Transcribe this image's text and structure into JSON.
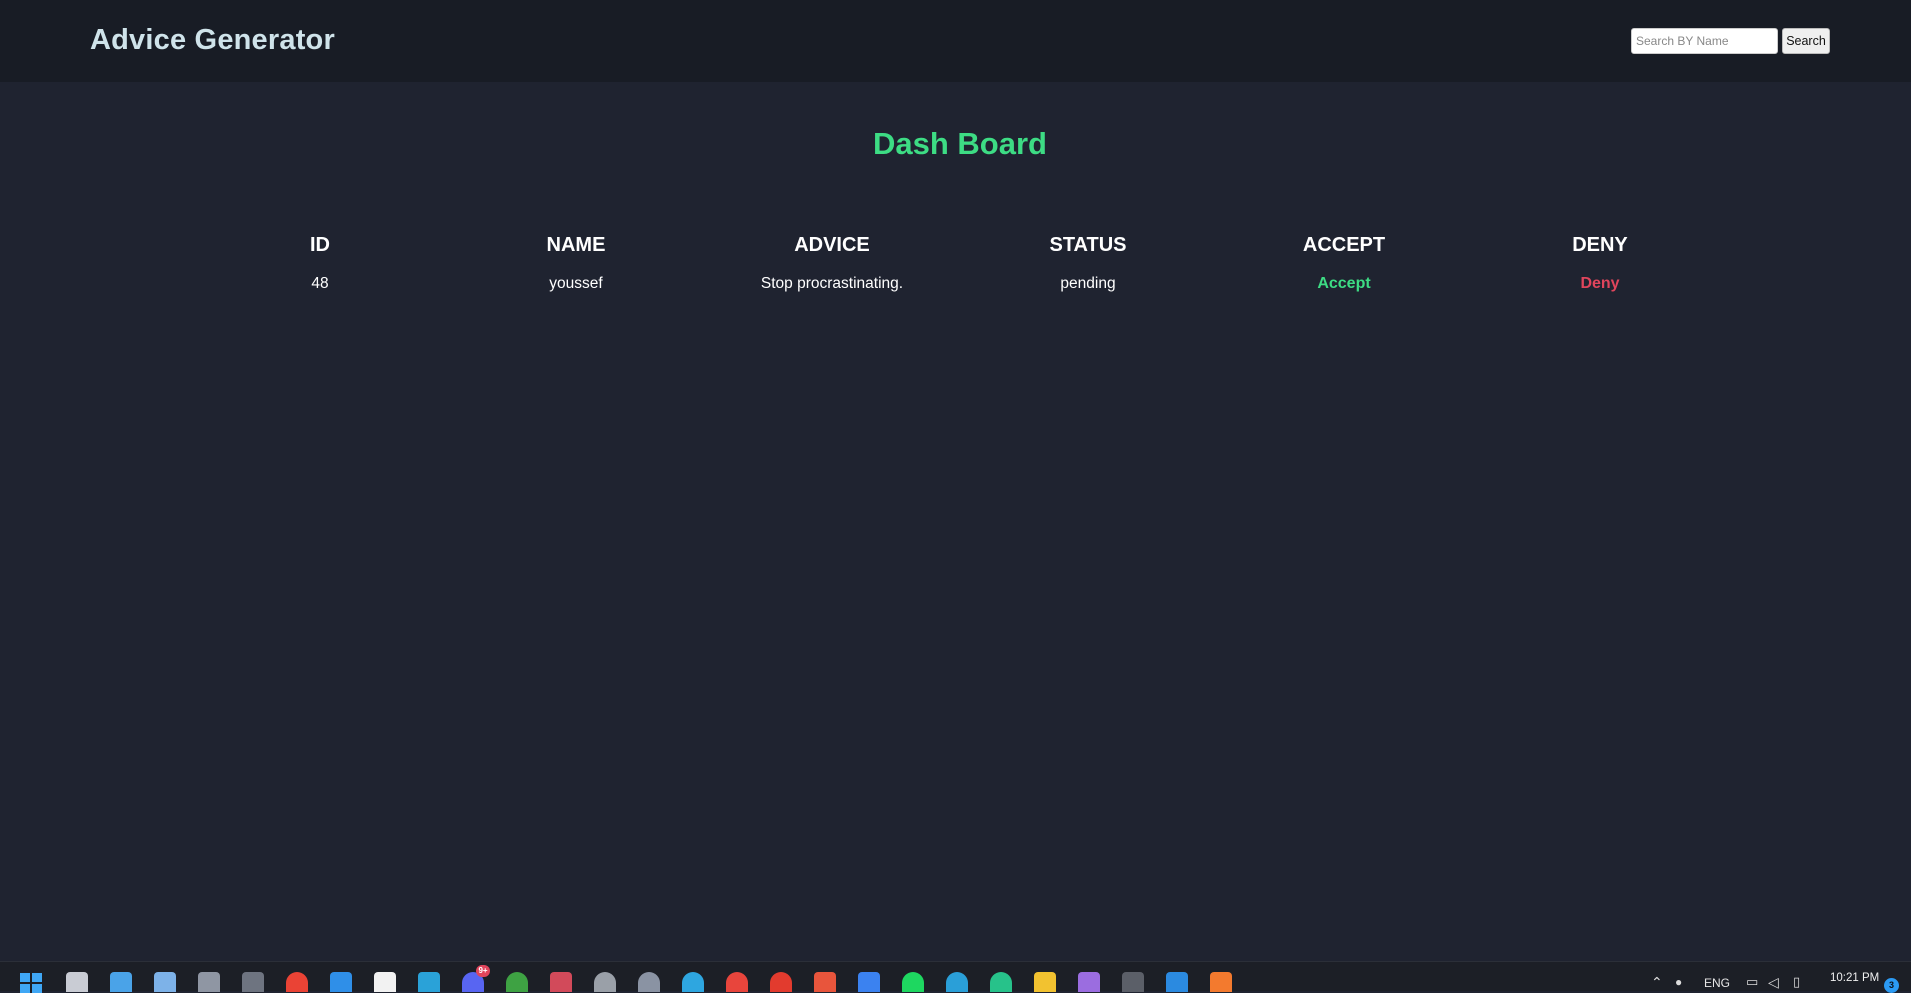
{
  "header": {
    "brand": "Advice Generator",
    "search_placeholder": "Search BY Name",
    "search_button": "Search"
  },
  "main": {
    "title": "Dash Board",
    "columns": [
      "ID",
      "NAME",
      "ADVICE",
      "STATUS",
      "ACCEPT",
      "DENY"
    ],
    "rows": [
      {
        "id": "48",
        "name": "youssef",
        "advice": "Stop procrastinating.",
        "status": "pending",
        "accept": "Accept",
        "deny": "Deny"
      }
    ]
  },
  "colors": {
    "background": "#1f2330",
    "header_bg": "#181c25",
    "brand": "#cfe3ea",
    "title": "#3ddc84",
    "accept": "#3ddc84",
    "deny": "#e0455c"
  },
  "taskbar": {
    "apps": [
      {
        "name": "windows-start-icon",
        "color": "#3fa7f5"
      },
      {
        "name": "file-stack-icon",
        "color": "#c9ccd4"
      },
      {
        "name": "photos-icon",
        "color": "#4aa3e8"
      },
      {
        "name": "chart-app-icon",
        "color": "#7db2e8"
      },
      {
        "name": "calculator-icon",
        "color": "#8f96a3"
      },
      {
        "name": "whatsapp-icon",
        "color": "#6e7480"
      },
      {
        "name": "google-icon",
        "color": "#ea4335"
      },
      {
        "name": "l-app-icon",
        "color": "#2f8fe8"
      },
      {
        "name": "readwise-icon",
        "color": "#f2f2f2"
      },
      {
        "name": "desktop-icon",
        "color": "#2aa2d8"
      },
      {
        "name": "discord-icon",
        "color": "#5865f2"
      },
      {
        "name": "xbox-icon",
        "color": "#3ea243"
      },
      {
        "name": "snipping-tool-icon",
        "color": "#d24a5a"
      },
      {
        "name": "obs-icon",
        "color": "#9aa0a8"
      },
      {
        "name": "settings-icon",
        "color": "#8a93a3"
      },
      {
        "name": "telegram-icon",
        "color": "#2ea6e0"
      },
      {
        "name": "chrome-icon",
        "color": "#e8453c"
      },
      {
        "name": "tomato-timer-icon",
        "color": "#e23b2e"
      },
      {
        "name": "office-icon",
        "color": "#e8553c"
      },
      {
        "name": "todo-icon",
        "color": "#3b82f0"
      },
      {
        "name": "spotify-icon",
        "color": "#1ed760"
      },
      {
        "name": "edge-icon",
        "color": "#2a9fd8"
      },
      {
        "name": "webstorm-icon",
        "color": "#27c28a"
      },
      {
        "name": "file-explorer-icon",
        "color": "#f2c230"
      },
      {
        "name": "git-icon",
        "color": "#9b6de0"
      },
      {
        "name": "terminal-icon",
        "color": "#5b5f68"
      },
      {
        "name": "vscode-icon",
        "color": "#2b8ae0"
      },
      {
        "name": "xampp-icon",
        "color": "#f37a2e"
      }
    ],
    "discord_badge": "9+",
    "language": "ENG",
    "time": "10:21 PM",
    "notifications": "3"
  }
}
